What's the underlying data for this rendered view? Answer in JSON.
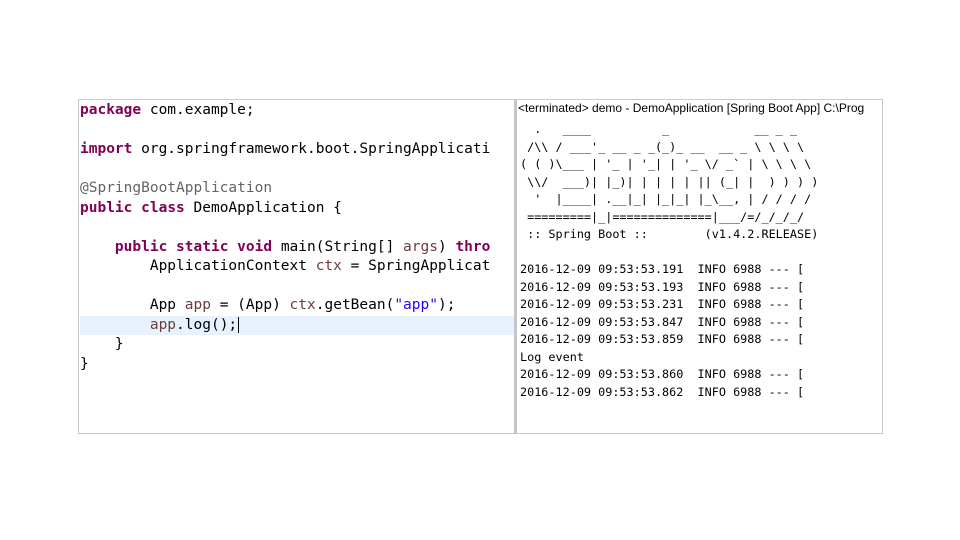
{
  "editor": {
    "lines": [
      [
        {
          "t": "package",
          "c": "kw"
        },
        {
          "t": " com.example;"
        }
      ],
      [],
      [
        {
          "t": "import",
          "c": "kw"
        },
        {
          "t": " org.springframework.boot.SpringApplicati"
        }
      ],
      [],
      [
        {
          "t": "@SpringBootApplication",
          "c": "ann"
        }
      ],
      [
        {
          "t": "public",
          "c": "kw"
        },
        {
          "t": " "
        },
        {
          "t": "class",
          "c": "kw"
        },
        {
          "t": " DemoApplication {"
        }
      ],
      [],
      [
        {
          "t": "    "
        },
        {
          "t": "public",
          "c": "kw"
        },
        {
          "t": " "
        },
        {
          "t": "static",
          "c": "kw"
        },
        {
          "t": " "
        },
        {
          "t": "void",
          "c": "kw"
        },
        {
          "t": " main(String[] "
        },
        {
          "t": "args",
          "c": "var"
        },
        {
          "t": ") "
        },
        {
          "t": "thro",
          "c": "kw"
        }
      ],
      [
        {
          "t": "        ApplicationContext "
        },
        {
          "t": "ctx",
          "c": "var"
        },
        {
          "t": " = SpringApplicat"
        }
      ],
      [],
      [
        {
          "t": "        App "
        },
        {
          "t": "app",
          "c": "var"
        },
        {
          "t": " = (App) "
        },
        {
          "t": "ctx",
          "c": "var"
        },
        {
          "t": ".getBean("
        },
        {
          "t": "\"app\"",
          "c": "str"
        },
        {
          "t": ");"
        }
      ],
      [
        {
          "t": "        "
        },
        {
          "t": "app",
          "c": "var"
        },
        {
          "t": ".log();"
        }
      ],
      [
        {
          "t": "    }"
        }
      ],
      [
        {
          "t": "}"
        }
      ]
    ],
    "current_line": 11
  },
  "console": {
    "header": "<terminated> demo - DemoApplication [Spring Boot App] C:\\Prog",
    "lines": [
      "  .   ____          _            __ _ _",
      " /\\\\ / ___'_ __ _ _(_)_ __  __ _ \\ \\ \\ \\",
      "( ( )\\___ | '_ | '_| | '_ \\/ _` | \\ \\ \\ \\",
      " \\\\/  ___)| |_)| | | | | || (_| |  ) ) ) )",
      "  '  |____| .__|_| |_|_| |_\\__, | / / / /",
      " =========|_|==============|___/=/_/_/_/",
      " :: Spring Boot ::        (v1.4.2.RELEASE)",
      "",
      "2016-12-09 09:53:53.191  INFO 6988 --- [",
      "2016-12-09 09:53:53.193  INFO 6988 --- [",
      "2016-12-09 09:53:53.231  INFO 6988 --- [",
      "2016-12-09 09:53:53.847  INFO 6988 --- [",
      "2016-12-09 09:53:53.859  INFO 6988 --- [",
      "Log event",
      "2016-12-09 09:53:53.860  INFO 6988 --- [",
      "2016-12-09 09:53:53.862  INFO 6988 --- ["
    ]
  }
}
